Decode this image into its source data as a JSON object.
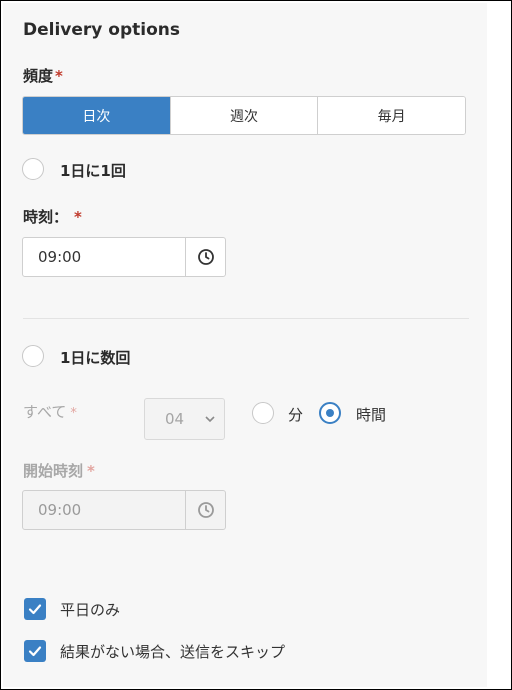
{
  "title": "Delivery options",
  "frequency": {
    "label": "頻度",
    "required_mark": "*",
    "options": [
      "日次",
      "週次",
      "毎月"
    ],
    "selected": "日次"
  },
  "once_a_day": {
    "label": "1日に1回",
    "selected": false,
    "time_label": "時刻：",
    "required_mark": "*",
    "time_value": "09:00"
  },
  "multiple_per_day": {
    "label": "1日に数回",
    "selected": false,
    "every_label": "すべて",
    "required_mark": "*",
    "interval_value": "04",
    "unit_minutes_label": "分",
    "unit_hours_label": "時間",
    "selected_unit": "時間",
    "start_time_label": "開始時刻",
    "start_time_value": "09:00"
  },
  "checkboxes": [
    {
      "label": "平日のみ",
      "checked": true
    },
    {
      "label": "結果がない場合、送信をスキップ",
      "checked": true
    }
  ],
  "colors": {
    "accent": "#3a80c4",
    "required": "#c0392b"
  }
}
